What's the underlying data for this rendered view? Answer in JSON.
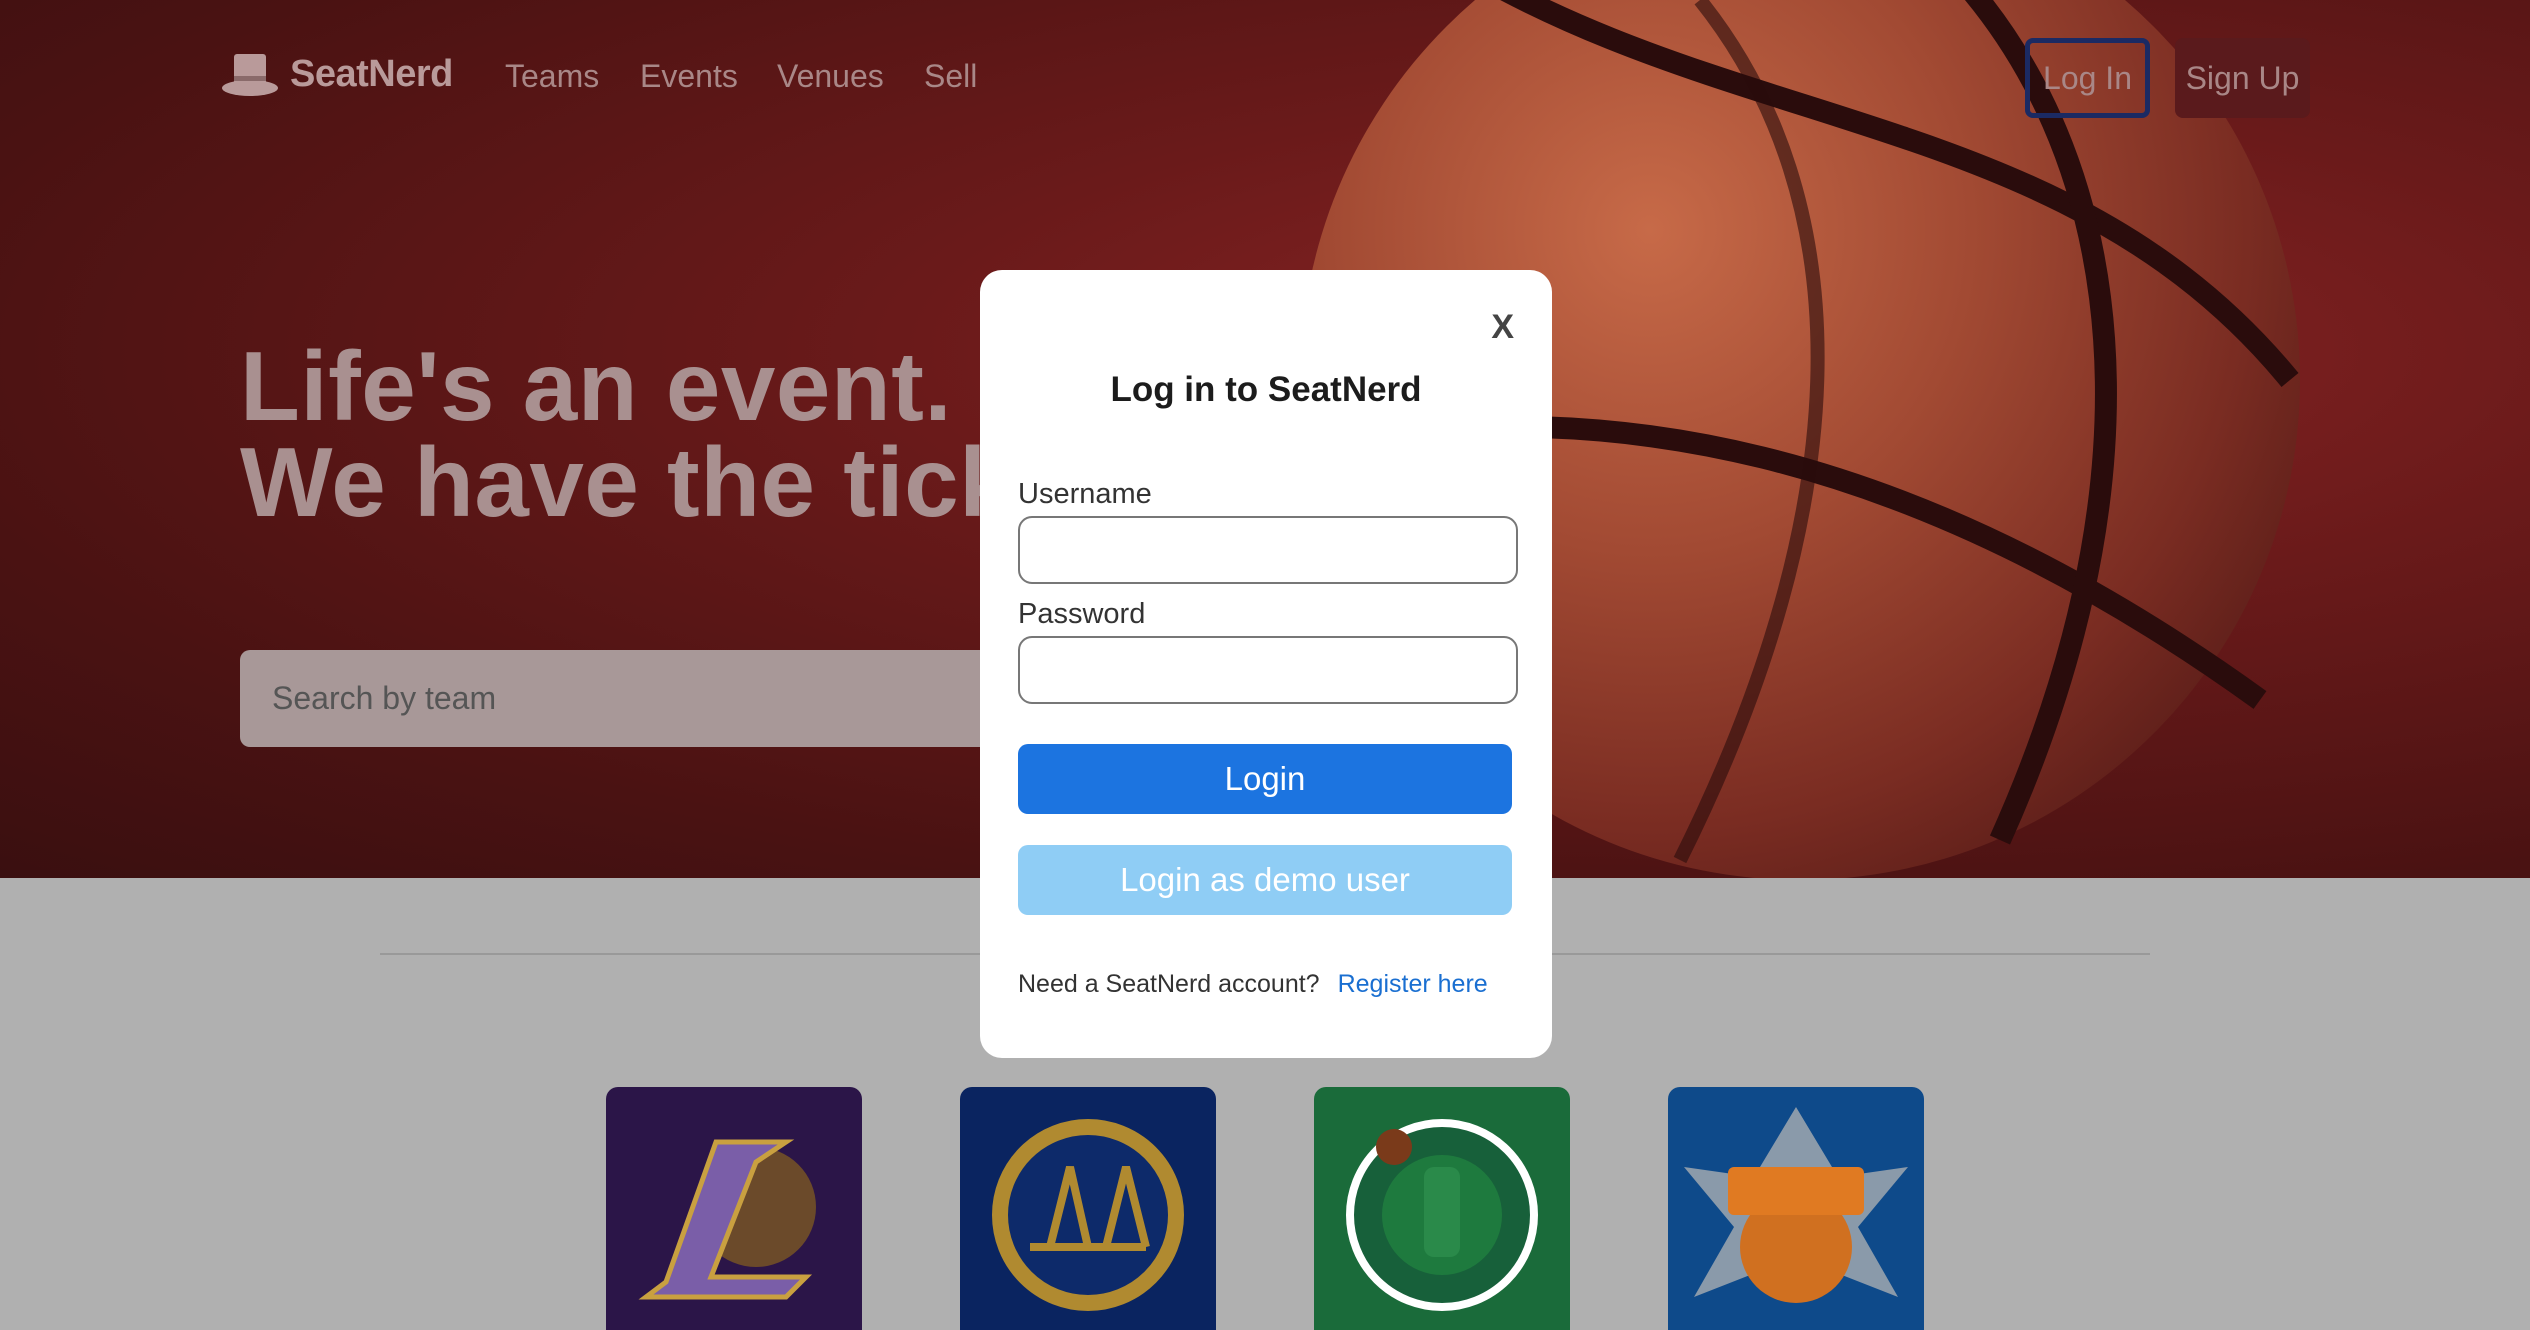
{
  "nav": {
    "brand": "SeatNerd",
    "links": [
      "Teams",
      "Events",
      "Venues",
      "Sell"
    ],
    "login_label": "Log In",
    "signup_label": "Sign Up"
  },
  "hero": {
    "headline_line1": "Life's an event.",
    "headline_line2": "We have the tick",
    "search_placeholder": "Search by team"
  },
  "teams": [
    {
      "icon": "lakers-logo",
      "color": "#2b1548"
    },
    {
      "icon": "warriors-logo",
      "color": "#0a2460"
    },
    {
      "icon": "celtics-logo",
      "color": "#1a6b3a"
    },
    {
      "icon": "knicks-logo",
      "color": "#0e4a8a"
    }
  ],
  "modal": {
    "close_label": "X",
    "title": "Log in to SeatNerd",
    "username_label": "Username",
    "password_label": "Password",
    "login_button": "Login",
    "demo_button": "Login as demo user",
    "register_prompt": "Need a SeatNerd account?",
    "register_link": "Register here"
  },
  "colors": {
    "primary": "#1c74e0",
    "demo": "#8fcdf5",
    "link": "#1a6fd1"
  }
}
